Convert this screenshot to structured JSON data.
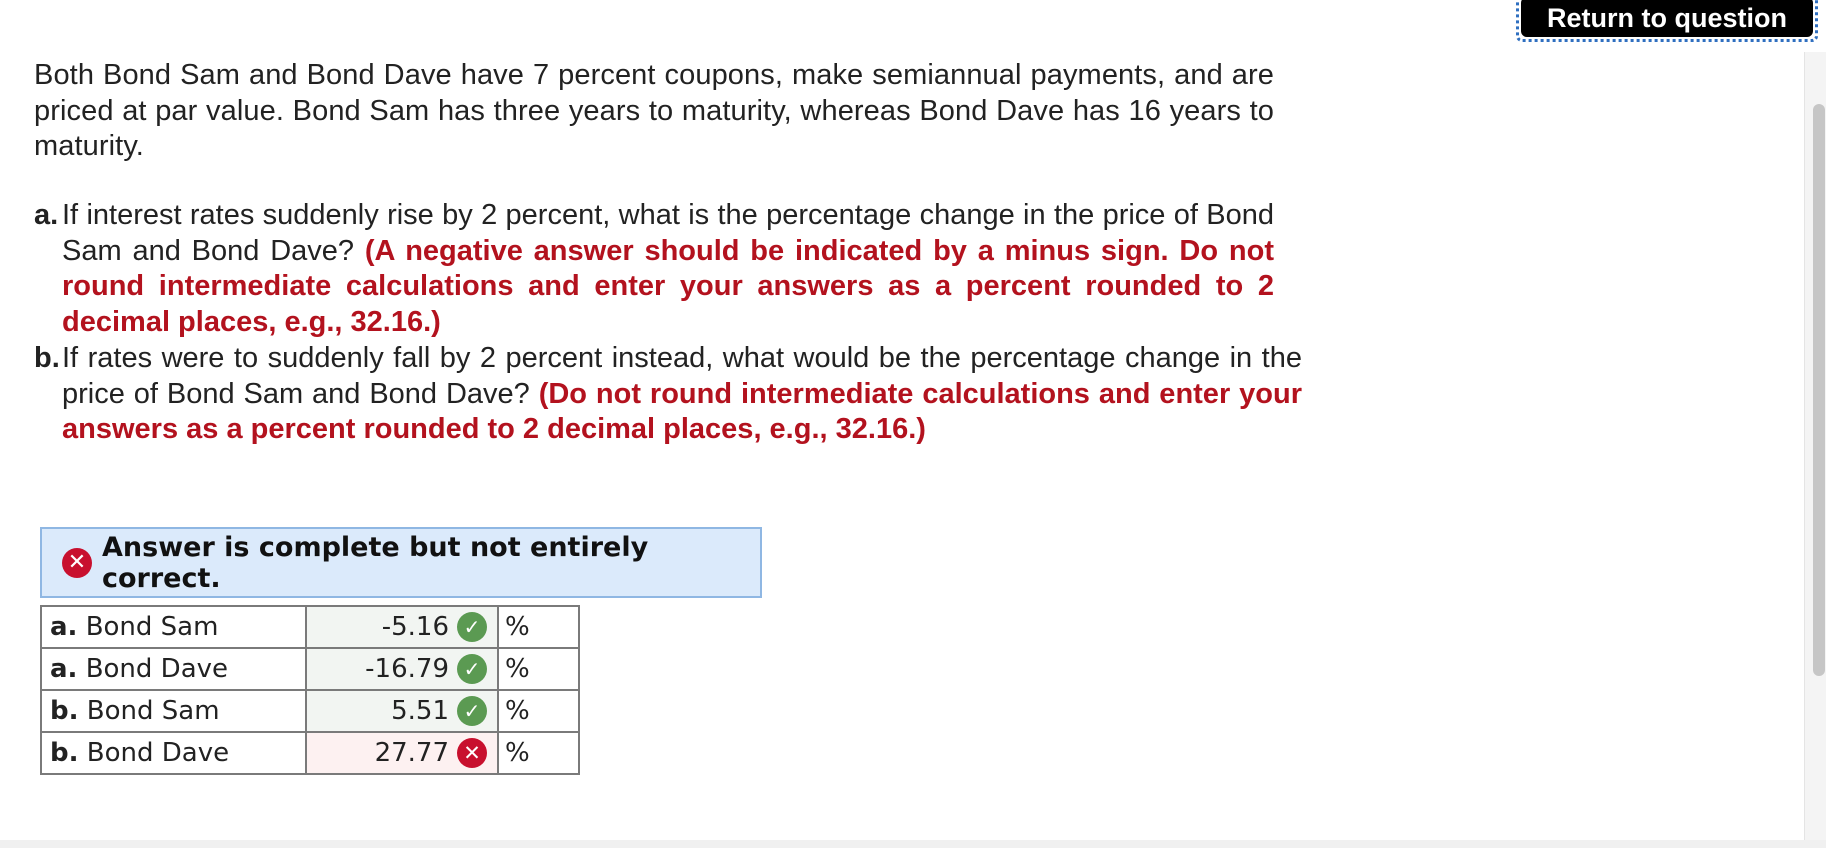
{
  "header": {
    "return_label": "Return to question"
  },
  "question": {
    "intro": "Both Bond Sam and Bond Dave have 7 percent coupons, make semiannual payments, and are priced at par value. Bond Sam has three years to maturity, whereas Bond Dave has 16 years to maturity.",
    "parts": [
      {
        "label": "a.",
        "text": "If interest rates suddenly rise by 2 percent, what is the percentage change in the price of Bond Sam and Bond Dave? ",
        "instruction": "(A negative answer should be indicated by a minus sign. Do not round intermediate calculations and enter your answers as a percent rounded to 2 decimal places, e.g., 32.16.)"
      },
      {
        "label": "b.",
        "text": "If rates were to suddenly fall by 2 percent instead, what would be the percentage change in the price of Bond Sam and Bond Dave? ",
        "instruction": "(Do not round intermediate calculations and enter your answers as a percent rounded to 2 decimal places, e.g., 32.16.)"
      }
    ]
  },
  "result": {
    "banner_text": "Answer is complete but not entirely correct."
  },
  "answers": {
    "rows": [
      {
        "part": "a.",
        "name": "Bond Sam",
        "value": "-5.16",
        "correct": true,
        "unit": "%"
      },
      {
        "part": "a.",
        "name": "Bond Dave",
        "value": "-16.79",
        "correct": true,
        "unit": "%"
      },
      {
        "part": "b.",
        "name": "Bond Sam",
        "value": "5.51",
        "correct": true,
        "unit": "%"
      },
      {
        "part": "b.",
        "name": "Bond Dave",
        "value": "27.77",
        "correct": false,
        "unit": "%"
      }
    ]
  },
  "icons": {
    "correct": "check-circle-icon",
    "incorrect": "x-circle-icon"
  },
  "colors": {
    "instruction_red": "#b3121e",
    "correct_green": "#5b9a52",
    "incorrect_red": "#c8102e",
    "banner_bg": "#dbeafb"
  }
}
